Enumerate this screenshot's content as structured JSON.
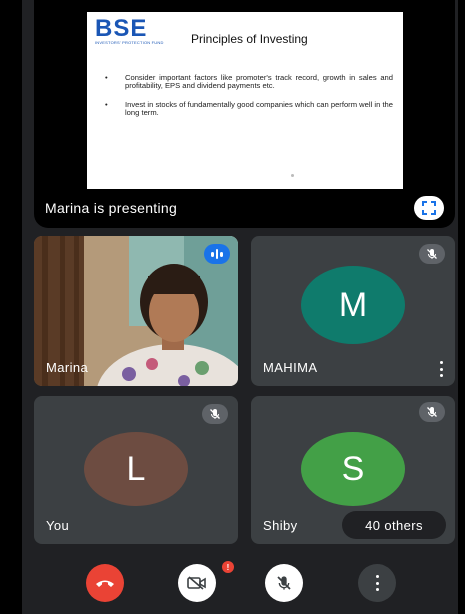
{
  "presentation": {
    "logo_text": "BSE",
    "logo_subtext": "INVESTORS' PROTECTION FUND",
    "slide_title": "Principles of Investing",
    "bullets": [
      "Consider important factors like promoter's track record, growth in sales and profitability, EPS and dividend payments etc.",
      "Invest in stocks of fundamentally good companies which can perform well in the long term."
    ],
    "bullet_glyph": "•",
    "presenter_label": "Marina is presenting",
    "fullscreen_icon": "fullscreen-icon"
  },
  "participants": [
    {
      "name": "Marina",
      "type": "video",
      "status_icon": "speaking-icon"
    },
    {
      "name": "MAHIMA",
      "initial": "M",
      "avatar_color": "#0f7b6c",
      "status_icon": "mic-off-icon",
      "has_menu": true
    },
    {
      "name": "You",
      "initial": "L",
      "avatar_color": "#6d4c41",
      "status_icon": "mic-off-icon"
    },
    {
      "name": "Shiby",
      "initial": "S",
      "avatar_color": "#43a047",
      "status_icon": "mic-off-icon",
      "extra": "40 others"
    }
  ],
  "controls": {
    "end_call": {
      "icon": "end-call-icon",
      "color": "#ea4335"
    },
    "camera": {
      "icon": "camera-off-icon",
      "color": "#ffffff",
      "badge": "!"
    },
    "mic": {
      "icon": "mic-off-icon",
      "color": "#ffffff"
    },
    "more": {
      "icon": "more-vert-icon",
      "color": "#3c4043"
    }
  }
}
